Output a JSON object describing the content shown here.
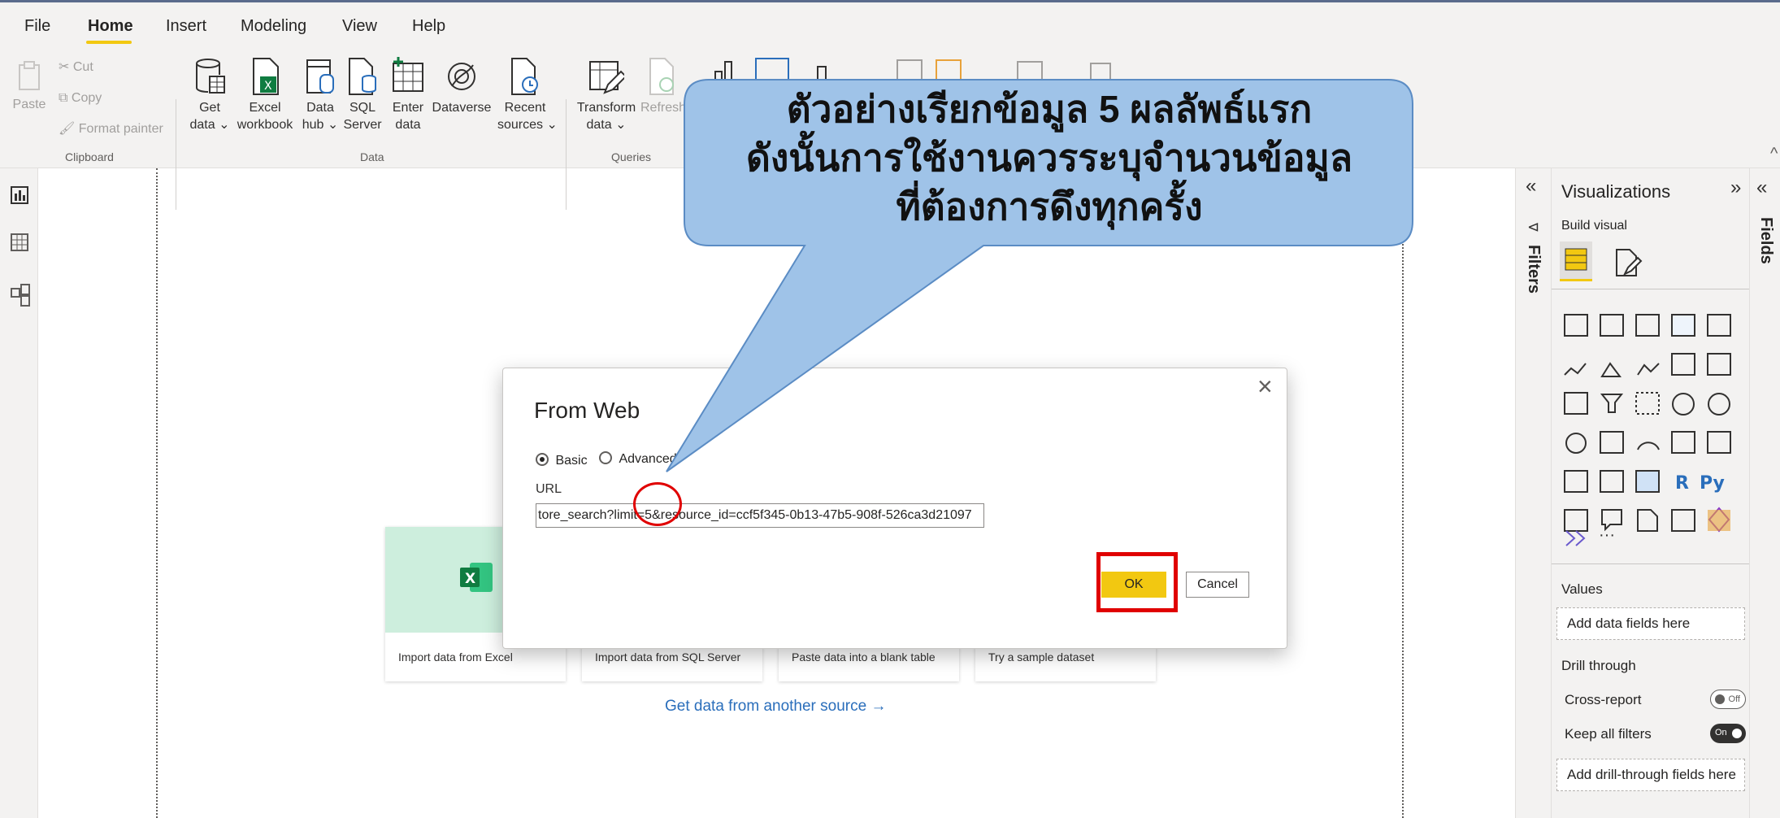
{
  "menu": [
    "File",
    "Home",
    "Insert",
    "Modeling",
    "View",
    "Help"
  ],
  "ribbon": {
    "clipboard": {
      "paste": "Paste",
      "cut": "Cut",
      "copy": "Copy",
      "format_painter": "Format painter",
      "group": "Clipboard"
    },
    "data": {
      "get_data": [
        "Get",
        "data ⌄"
      ],
      "excel": [
        "Excel",
        "workbook"
      ],
      "data_hub": [
        "Data",
        "hub ⌄"
      ],
      "sql": [
        "SQL",
        "Server"
      ],
      "enter_data": [
        "Enter",
        "data"
      ],
      "dataverse": "Dataverse",
      "recent": [
        "Recent",
        "sources ⌄"
      ],
      "group": "Data"
    },
    "queries": {
      "transform": [
        "Transform",
        "data ⌄"
      ],
      "refresh": "Refresh",
      "group": "Queries"
    }
  },
  "callout": {
    "line1": "ตัวอย่างเรียกข้อมูล 5 ผลลัพธ์แรก",
    "line2": "ดังนั้นการใช้งานควรระบุจำนวนข้อมูล",
    "line3": "ที่ต้องการดึงทุกครั้ง"
  },
  "dialog": {
    "title": "From Web",
    "basic": "Basic",
    "advanced": "Advanced",
    "basic_selected": true,
    "url_label": "URL",
    "url_value": "tore_search?limit=5&resource_id=ccf5f345-0b13-47b5-908f-526ca3d21097",
    "ok": "OK",
    "cancel": "Cancel",
    "close": "×"
  },
  "cards": [
    "Import data from Excel",
    "Import data from SQL Server",
    "Paste data into a blank table",
    "Try a sample dataset"
  ],
  "get_data_link": "Get data from another source →",
  "filters_label": "Filters",
  "fields_label": "Fields",
  "visualizations": {
    "title": "Visualizations",
    "build_visual": "Build visual",
    "values": "Values",
    "add_data_fields": "Add data fields here",
    "drill_through": "Drill through",
    "cross_report": "Cross-report",
    "cross_report_toggle": "Off",
    "keep_all_filters": "Keep all filters",
    "keep_all_filters_toggle": "On",
    "add_drill_fields": "Add drill-through fields here",
    "more": "···"
  },
  "colors": {
    "accent": "#f2c811",
    "highlight_box": "#e00000",
    "callout_fill": "#9fc3e8",
    "link": "#2a6ebb",
    "excel_green": "#107c41"
  }
}
